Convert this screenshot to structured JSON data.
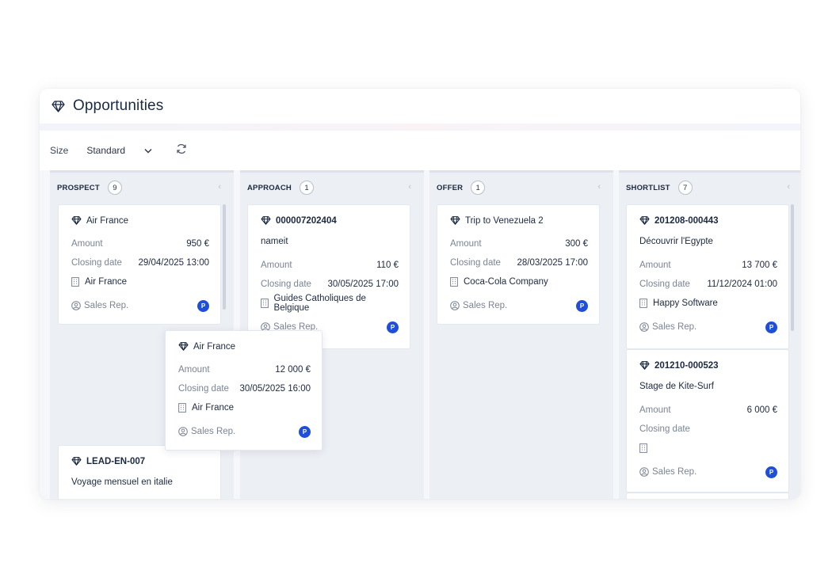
{
  "header": {
    "title": "Opportunities",
    "icon": "diamond-icon"
  },
  "toolbar": {
    "size_label": "Size",
    "size_value": "Standard",
    "refresh_icon": "refresh-icon"
  },
  "labels": {
    "amount": "Amount",
    "closing_date": "Closing date",
    "sales_rep": "Sales Rep.",
    "badge": "P"
  },
  "columns": [
    {
      "name": "PROSPECT",
      "count": "9",
      "cards": [
        {
          "title": "Air France",
          "amount": "950 €",
          "closing_date": "29/04/2025 13:00",
          "company": "Air France"
        },
        {
          "title": "LEAD-EN-007",
          "subtitle": "Voyage mensuel en italie"
        }
      ]
    },
    {
      "name": "APPROACH",
      "count": "1",
      "cards": [
        {
          "title": "000007202404",
          "subtitle": "nameit",
          "amount": "110 €",
          "closing_date": "30/05/2025 17:00",
          "company": "Guides Catholiques de Belgique"
        }
      ]
    },
    {
      "name": "OFFER",
      "count": "1",
      "cards": [
        {
          "title": "Trip to Venezuela 2",
          "amount": "300 €",
          "closing_date": "28/03/2025 17:00",
          "company": "Coca-Cola Company"
        }
      ]
    },
    {
      "name": "SHORTLIST",
      "count": "7",
      "cards": [
        {
          "title": "201208-000443",
          "subtitle": "Découvrir l'Egypte",
          "amount": "13 700 €",
          "closing_date": "11/12/2024 01:00",
          "company": "Happy Software"
        },
        {
          "title": "201210-000523",
          "subtitle": "Stage de Kite-Surf",
          "amount": "6 000 €",
          "closing_date": "",
          "company": ""
        }
      ]
    }
  ],
  "dragging_card": {
    "title": "Air France",
    "amount": "12 000 €",
    "closing_date": "30/05/2025 16:00",
    "company": "Air France"
  }
}
